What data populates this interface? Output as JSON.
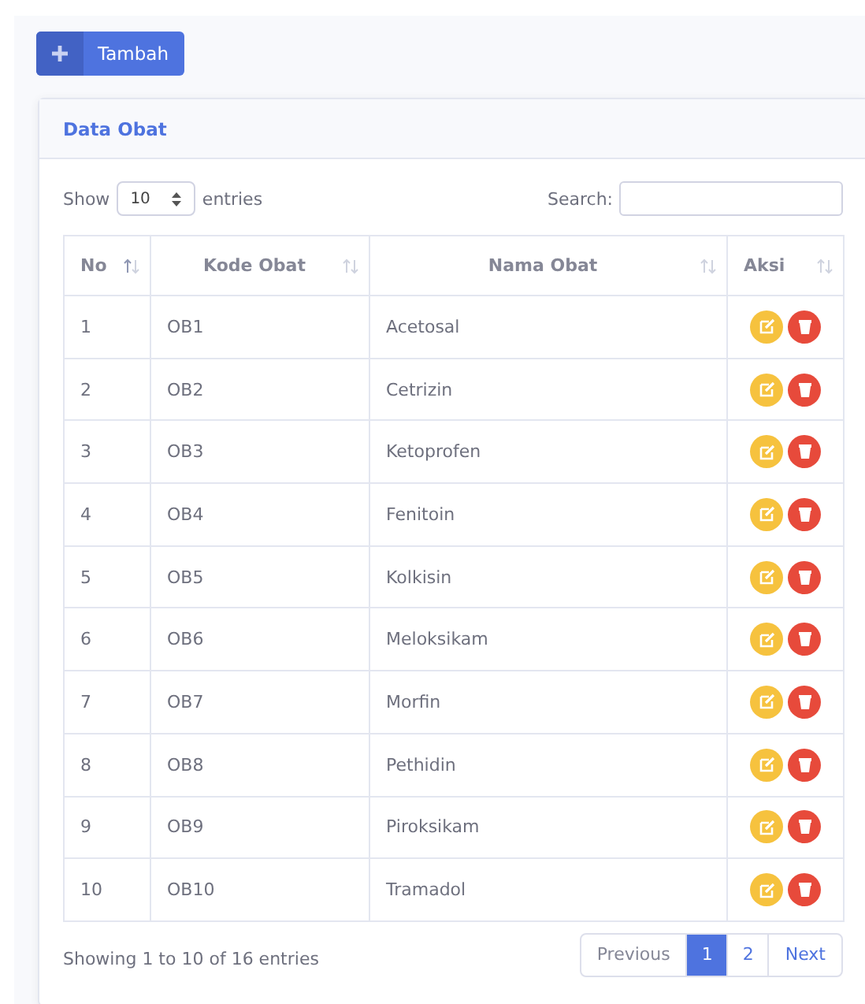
{
  "add_button": {
    "label": "Tambah"
  },
  "card": {
    "title": "Data Obat"
  },
  "length": {
    "before": "Show",
    "value": "10",
    "after": "entries"
  },
  "search": {
    "label": "Search:"
  },
  "table": {
    "columns": [
      "No",
      "Kode Obat",
      "Nama Obat",
      "Aksi"
    ],
    "rows": [
      {
        "no": "1",
        "code": "OB1",
        "name": "Acetosal"
      },
      {
        "no": "2",
        "code": "OB2",
        "name": "Cetrizin"
      },
      {
        "no": "3",
        "code": "OB3",
        "name": "Ketoprofen"
      },
      {
        "no": "4",
        "code": "OB4",
        "name": "Fenitoin"
      },
      {
        "no": "5",
        "code": "OB5",
        "name": "Kolkisin"
      },
      {
        "no": "6",
        "code": "OB6",
        "name": "Meloksikam"
      },
      {
        "no": "7",
        "code": "OB7",
        "name": "Morfin"
      },
      {
        "no": "8",
        "code": "OB8",
        "name": "Pethidin"
      },
      {
        "no": "9",
        "code": "OB9",
        "name": "Piroksikam"
      },
      {
        "no": "10",
        "code": "OB10",
        "name": "Tramadol"
      }
    ]
  },
  "info": "Showing 1 to 10 of 16 entries",
  "pagination": [
    {
      "label": "Previous",
      "kind": "nav",
      "selected": false
    },
    {
      "label": "1",
      "kind": "page",
      "selected": true
    },
    {
      "label": "2",
      "kind": "page",
      "selected": false
    },
    {
      "label": "Next",
      "kind": "nav",
      "selected": false
    }
  ]
}
